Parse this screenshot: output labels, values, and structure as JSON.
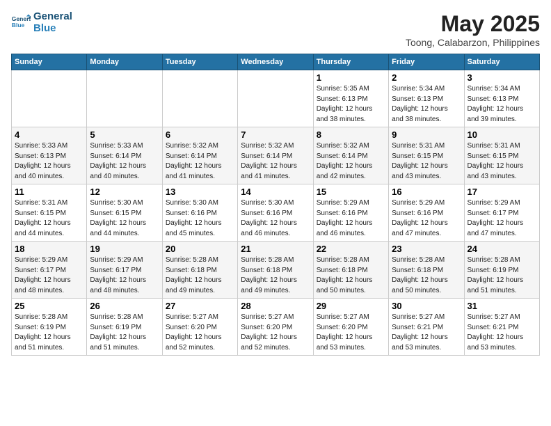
{
  "logo": {
    "line1": "General",
    "line2": "Blue"
  },
  "title": "May 2025",
  "subtitle": "Toong, Calabarzon, Philippines",
  "weekdays": [
    "Sunday",
    "Monday",
    "Tuesday",
    "Wednesday",
    "Thursday",
    "Friday",
    "Saturday"
  ],
  "weeks": [
    [
      {
        "day": "",
        "info": ""
      },
      {
        "day": "",
        "info": ""
      },
      {
        "day": "",
        "info": ""
      },
      {
        "day": "",
        "info": ""
      },
      {
        "day": "1",
        "info": "Sunrise: 5:35 AM\nSunset: 6:13 PM\nDaylight: 12 hours\nand 38 minutes."
      },
      {
        "day": "2",
        "info": "Sunrise: 5:34 AM\nSunset: 6:13 PM\nDaylight: 12 hours\nand 38 minutes."
      },
      {
        "day": "3",
        "info": "Sunrise: 5:34 AM\nSunset: 6:13 PM\nDaylight: 12 hours\nand 39 minutes."
      }
    ],
    [
      {
        "day": "4",
        "info": "Sunrise: 5:33 AM\nSunset: 6:13 PM\nDaylight: 12 hours\nand 40 minutes."
      },
      {
        "day": "5",
        "info": "Sunrise: 5:33 AM\nSunset: 6:14 PM\nDaylight: 12 hours\nand 40 minutes."
      },
      {
        "day": "6",
        "info": "Sunrise: 5:32 AM\nSunset: 6:14 PM\nDaylight: 12 hours\nand 41 minutes."
      },
      {
        "day": "7",
        "info": "Sunrise: 5:32 AM\nSunset: 6:14 PM\nDaylight: 12 hours\nand 41 minutes."
      },
      {
        "day": "8",
        "info": "Sunrise: 5:32 AM\nSunset: 6:14 PM\nDaylight: 12 hours\nand 42 minutes."
      },
      {
        "day": "9",
        "info": "Sunrise: 5:31 AM\nSunset: 6:15 PM\nDaylight: 12 hours\nand 43 minutes."
      },
      {
        "day": "10",
        "info": "Sunrise: 5:31 AM\nSunset: 6:15 PM\nDaylight: 12 hours\nand 43 minutes."
      }
    ],
    [
      {
        "day": "11",
        "info": "Sunrise: 5:31 AM\nSunset: 6:15 PM\nDaylight: 12 hours\nand 44 minutes."
      },
      {
        "day": "12",
        "info": "Sunrise: 5:30 AM\nSunset: 6:15 PM\nDaylight: 12 hours\nand 44 minutes."
      },
      {
        "day": "13",
        "info": "Sunrise: 5:30 AM\nSunset: 6:16 PM\nDaylight: 12 hours\nand 45 minutes."
      },
      {
        "day": "14",
        "info": "Sunrise: 5:30 AM\nSunset: 6:16 PM\nDaylight: 12 hours\nand 46 minutes."
      },
      {
        "day": "15",
        "info": "Sunrise: 5:29 AM\nSunset: 6:16 PM\nDaylight: 12 hours\nand 46 minutes."
      },
      {
        "day": "16",
        "info": "Sunrise: 5:29 AM\nSunset: 6:16 PM\nDaylight: 12 hours\nand 47 minutes."
      },
      {
        "day": "17",
        "info": "Sunrise: 5:29 AM\nSunset: 6:17 PM\nDaylight: 12 hours\nand 47 minutes."
      }
    ],
    [
      {
        "day": "18",
        "info": "Sunrise: 5:29 AM\nSunset: 6:17 PM\nDaylight: 12 hours\nand 48 minutes."
      },
      {
        "day": "19",
        "info": "Sunrise: 5:29 AM\nSunset: 6:17 PM\nDaylight: 12 hours\nand 48 minutes."
      },
      {
        "day": "20",
        "info": "Sunrise: 5:28 AM\nSunset: 6:18 PM\nDaylight: 12 hours\nand 49 minutes."
      },
      {
        "day": "21",
        "info": "Sunrise: 5:28 AM\nSunset: 6:18 PM\nDaylight: 12 hours\nand 49 minutes."
      },
      {
        "day": "22",
        "info": "Sunrise: 5:28 AM\nSunset: 6:18 PM\nDaylight: 12 hours\nand 50 minutes."
      },
      {
        "day": "23",
        "info": "Sunrise: 5:28 AM\nSunset: 6:18 PM\nDaylight: 12 hours\nand 50 minutes."
      },
      {
        "day": "24",
        "info": "Sunrise: 5:28 AM\nSunset: 6:19 PM\nDaylight: 12 hours\nand 51 minutes."
      }
    ],
    [
      {
        "day": "25",
        "info": "Sunrise: 5:28 AM\nSunset: 6:19 PM\nDaylight: 12 hours\nand 51 minutes."
      },
      {
        "day": "26",
        "info": "Sunrise: 5:28 AM\nSunset: 6:19 PM\nDaylight: 12 hours\nand 51 minutes."
      },
      {
        "day": "27",
        "info": "Sunrise: 5:27 AM\nSunset: 6:20 PM\nDaylight: 12 hours\nand 52 minutes."
      },
      {
        "day": "28",
        "info": "Sunrise: 5:27 AM\nSunset: 6:20 PM\nDaylight: 12 hours\nand 52 minutes."
      },
      {
        "day": "29",
        "info": "Sunrise: 5:27 AM\nSunset: 6:20 PM\nDaylight: 12 hours\nand 53 minutes."
      },
      {
        "day": "30",
        "info": "Sunrise: 5:27 AM\nSunset: 6:21 PM\nDaylight: 12 hours\nand 53 minutes."
      },
      {
        "day": "31",
        "info": "Sunrise: 5:27 AM\nSunset: 6:21 PM\nDaylight: 12 hours\nand 53 minutes."
      }
    ]
  ]
}
